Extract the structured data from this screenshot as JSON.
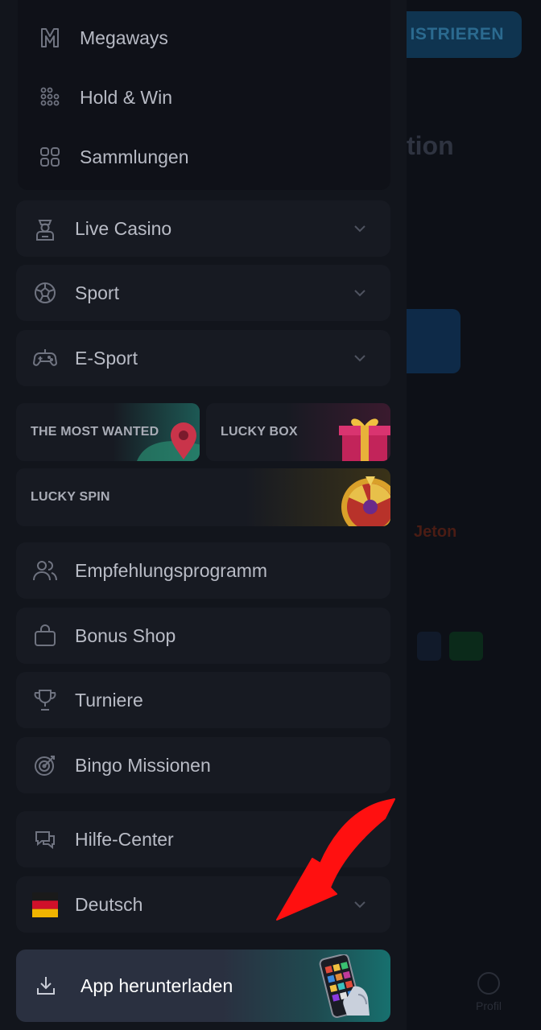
{
  "background": {
    "register_label": "ISTRIEREN",
    "heading_fragment": "tion",
    "jeton_label": "Jeton",
    "profile_label": "Profil"
  },
  "submenu": {
    "items": [
      {
        "label": "Megaways",
        "icon": "megaways-icon"
      },
      {
        "label": "Hold & Win",
        "icon": "hold-win-icon"
      },
      {
        "label": "Sammlungen",
        "icon": "collections-icon"
      }
    ]
  },
  "sections": [
    {
      "label": "Live Casino",
      "icon": "dealer-icon",
      "expandable": true
    },
    {
      "label": "Sport",
      "icon": "soccer-ball-icon",
      "expandable": true
    },
    {
      "label": "E-Sport",
      "icon": "gamepad-icon",
      "expandable": true
    }
  ],
  "promos": [
    {
      "label": "THE MOST WANTED",
      "icon": "map-pin-icon"
    },
    {
      "label": "LUCKY BOX",
      "icon": "gift-box-icon"
    },
    {
      "label": "LUCKY SPIN",
      "icon": "wheel-icon"
    }
  ],
  "links": [
    {
      "label": "Empfehlungsprogramm",
      "icon": "users-icon"
    },
    {
      "label": "Bonus Shop",
      "icon": "shopping-bag-icon"
    },
    {
      "label": "Turniere",
      "icon": "trophy-icon"
    },
    {
      "label": "Bingo Missionen",
      "icon": "target-icon"
    }
  ],
  "support": [
    {
      "label": "Hilfe-Center",
      "icon": "chat-icon",
      "expandable": true
    },
    {
      "label": "Deutsch",
      "icon": "german-flag-icon",
      "expandable": true
    }
  ],
  "download": {
    "label": "App herunterladen",
    "icon": "download-icon"
  },
  "colors": {
    "accent_arrow": "#ff1010",
    "drawer_bg": "#12151c",
    "card_bg": "#171a22"
  }
}
